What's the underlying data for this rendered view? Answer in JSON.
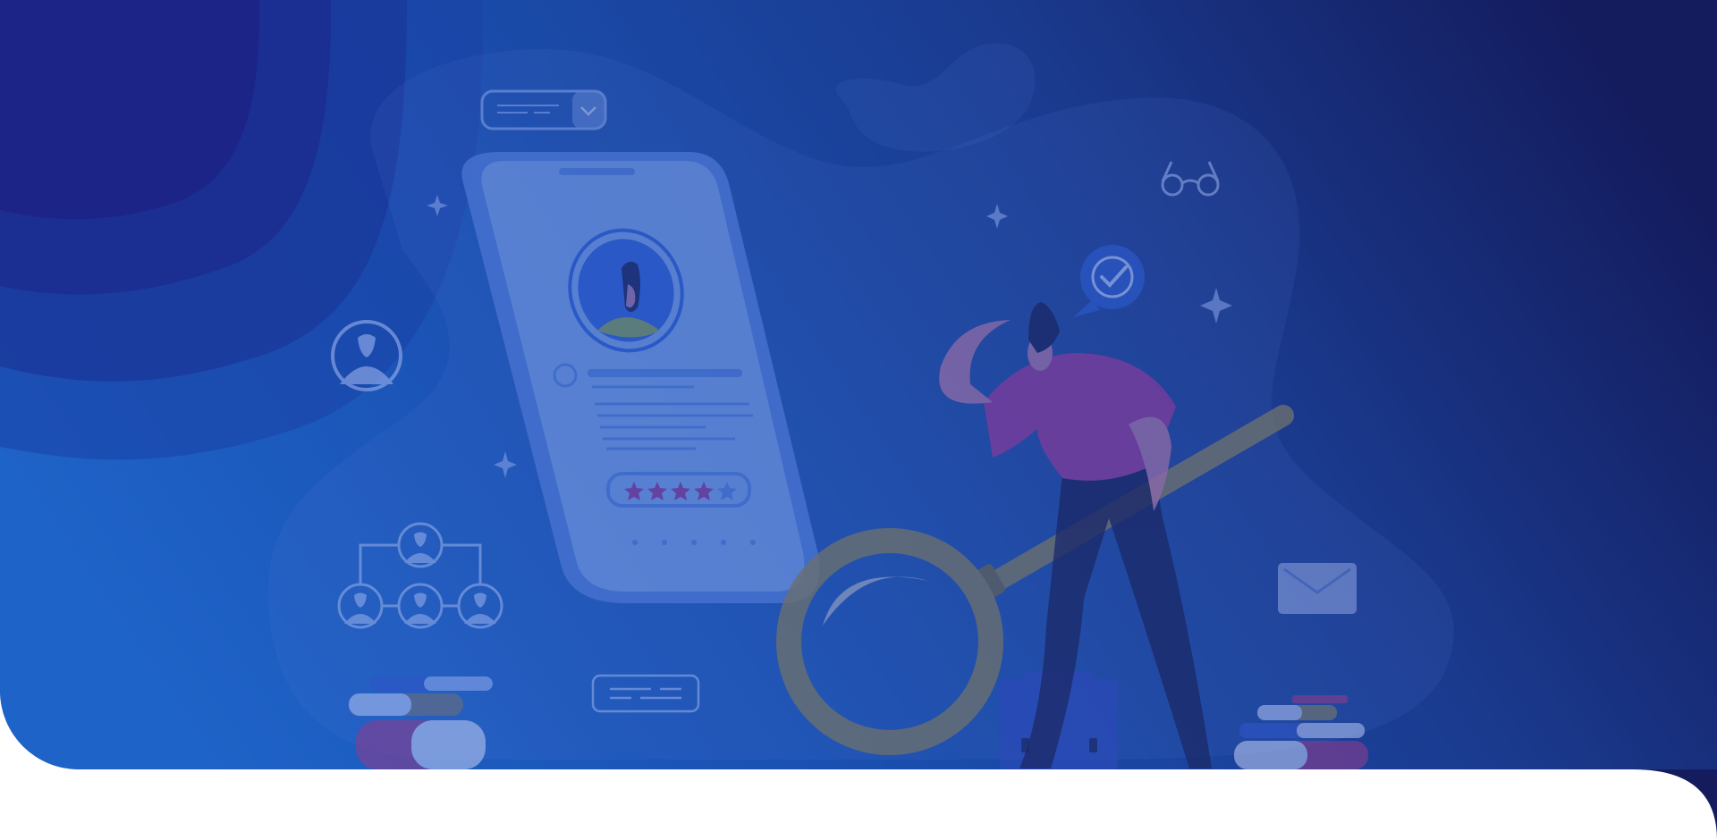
{
  "scene": {
    "name": "hero-illustration",
    "subject": "person-with-magnifying-glass-reviewing-phone-profile",
    "rating": {
      "stars_total": 5,
      "stars_filled": 4
    },
    "icons": [
      "user-icon",
      "org-chart-icon",
      "glasses-icon",
      "check-badge-icon",
      "envelope-icon",
      "sparkle-icon",
      "books-icon",
      "briefcase-icon",
      "dropdown-icon",
      "text-card-icon"
    ]
  },
  "colors": {
    "gradient_start": "#1e63c8",
    "gradient_mid": "#1a4fb0",
    "gradient_end": "#141c5e",
    "corner_blob": "#1f1a7a",
    "accent_purple": "#7a3d9c",
    "icon_line": "#6f8fe0",
    "magnifier": "#6b7070",
    "white": "#ffffff"
  }
}
